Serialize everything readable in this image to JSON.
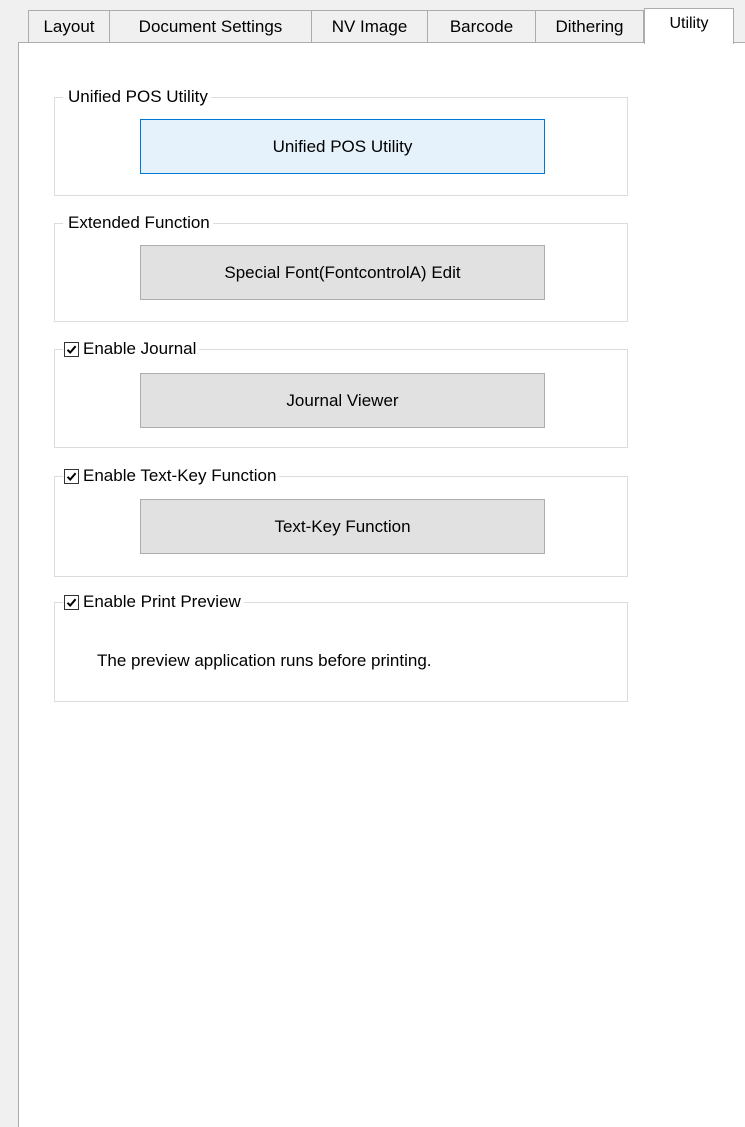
{
  "tabs": [
    {
      "label": "Layout"
    },
    {
      "label": "Document Settings"
    },
    {
      "label": "NV Image"
    },
    {
      "label": "Barcode"
    },
    {
      "label": "Dithering"
    },
    {
      "label": "Utility",
      "active": true
    }
  ],
  "groups": {
    "upos": {
      "title": "Unified POS Utility",
      "button_label": "Unified POS Utility"
    },
    "extended": {
      "title": "Extended Function",
      "button_label": "Special Font(FontcontrolA) Edit"
    },
    "journal": {
      "title": "Enable Journal",
      "checked": true,
      "button_label": "Journal Viewer"
    },
    "textkey": {
      "title": "Enable Text-Key Function",
      "checked": true,
      "button_label": "Text-Key Function"
    },
    "preview": {
      "title": "Enable Print Preview",
      "checked": true,
      "description": "The preview application runs before printing."
    }
  },
  "colors": {
    "focus_border": "#0078d7",
    "button_face": "#e1e1e1",
    "panel_background": "#ffffff",
    "window_background": "#f0f0f0"
  }
}
